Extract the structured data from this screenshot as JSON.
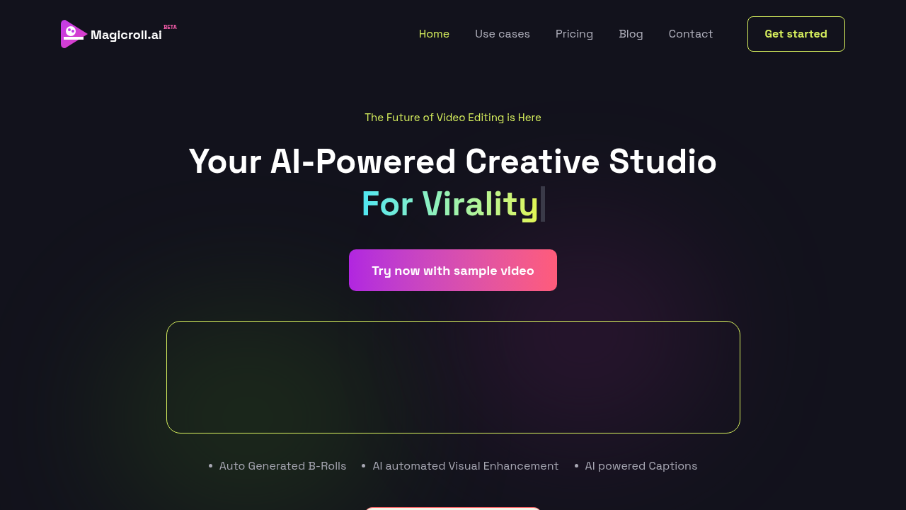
{
  "logo": {
    "name": "Magicroll.ai",
    "badge": "BETA"
  },
  "nav": [
    {
      "label": "Home",
      "selected": true
    },
    {
      "label": "Use cases",
      "selected": false
    },
    {
      "label": "Pricing",
      "selected": false
    },
    {
      "label": "Blog",
      "selected": false
    },
    {
      "label": "Contact",
      "selected": false
    }
  ],
  "cta": "Get started",
  "hero": {
    "eyebrow": "The Future of Video Editing is Here",
    "title": "Your AI-Powered Creative Studio",
    "highlight": "For Virality",
    "button": "Try now with sample video"
  },
  "features": [
    "Auto Generated B-Rolls",
    "AI automated Visual Enhancement",
    "AI powered Captions"
  ]
}
